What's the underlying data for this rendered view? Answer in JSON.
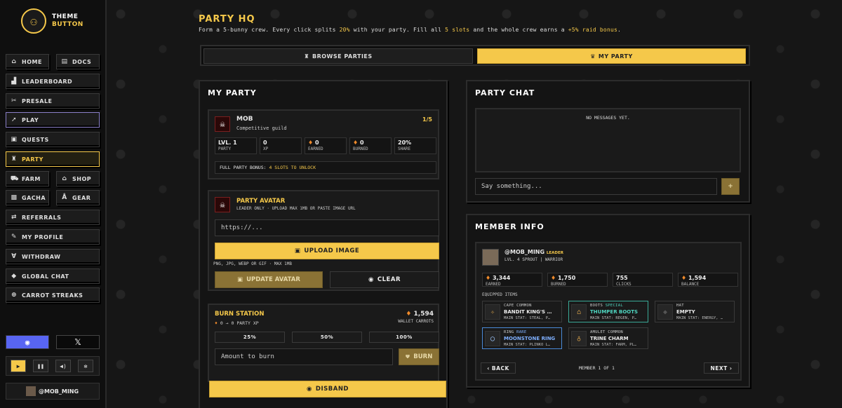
{
  "sidebar": {
    "logo": {
      "line1": "THEME",
      "line2": "BUTTON"
    },
    "nav": {
      "home": "HOME",
      "docs": "DOCS",
      "leaderboard": "LEADERBOARD",
      "presale": "PRESALE",
      "play": "PLAY",
      "quests": "QUESTS",
      "party": "PARTY",
      "farm": "FARM",
      "shop": "SHOP",
      "gacha": "GACHA",
      "gear": "GEAR",
      "referrals": "REFERRALS",
      "profile": "MY PROFILE",
      "withdraw": "WITHDRAW",
      "global_chat": "GLOBAL CHAT",
      "carrot_streaks": "CARROT STREAKS"
    },
    "social": {
      "x": "𝕏"
    },
    "user": {
      "name": "@MOB_MING"
    }
  },
  "header": {
    "title": "PARTY HQ",
    "sub_parts": [
      "Form a 5-bunny crew. Every click splits ",
      "20%",
      " with your party. Fill all ",
      "5 slots",
      " and the whole crew earns a ",
      "+5% raid bonus",
      "."
    ]
  },
  "tabs": {
    "browse": "BROWSE PARTIES",
    "mine": "MY PARTY"
  },
  "my_party": {
    "title": "MY PARTY",
    "name": "MOB",
    "desc": "Competitive guild",
    "count": "1/5",
    "stats": {
      "level": {
        "value": "LVL. 1",
        "label": "PARTY"
      },
      "xp": {
        "value": "0",
        "label": "XP"
      },
      "earned": {
        "value": "0",
        "label": "EARNED"
      },
      "burned": {
        "value": "0",
        "label": "BURNED"
      },
      "share": {
        "value": "20%",
        "label": "SHARE"
      }
    },
    "bonus_prefix": "FULL PARTY BONUS: ",
    "bonus_value": "4 SLOTS TO UNLOCK"
  },
  "avatar": {
    "title": "PARTY AVATAR",
    "desc": "LEADER ONLY · UPLOAD MAX 1MB OR PASTE IMAGE URL",
    "url_placeholder": "https://...",
    "upload": "UPLOAD IMAGE",
    "formats": "PNG, JPG, WEBP OR GIF · MAX 1MB",
    "update": "UPDATE AVATAR",
    "clear": "CLEAR"
  },
  "burn": {
    "title": "BURN STATION",
    "rate_left": "0",
    "rate_right": "→ 0 PARTY XP",
    "wallet_value": "1,594",
    "wallet_label": "WALLET CARROTS",
    "p25": "25%",
    "p50": "50%",
    "p100": "100%",
    "amount_placeholder": "Amount to burn",
    "burn_btn": "BURN"
  },
  "disband": "DISBAND",
  "chat": {
    "title": "PARTY CHAT",
    "empty": "NO MESSAGES YET.",
    "placeholder": "Say something...",
    "send_icon": "+"
  },
  "member": {
    "title": "MEMBER INFO",
    "handle": "@MOB_MING",
    "role": "LEADER",
    "sub_left": "LVL. 4 SPROUT",
    "sub_right": "WARRIOR",
    "stats": {
      "earned": {
        "value": "3,344",
        "label": "EARNED"
      },
      "burned": {
        "value": "1,750",
        "label": "BURNED"
      },
      "clicks": {
        "value": "755",
        "label": "CLICKS"
      },
      "balance": {
        "value": "1,594",
        "label": "BALANCE"
      }
    },
    "equipped_label": "EQUIPPED ITEMS",
    "items": [
      {
        "slot": "CAPE",
        "rarity": "COMMON",
        "name": "BANDIT KING'S …",
        "stat": "MAIN STAT: STEAL, P…"
      },
      {
        "slot": "BOOTS",
        "rarity": "SPECIAL",
        "name": "THUMPER BOOTS",
        "stat": "MAIN STAT: REGEN, P…"
      },
      {
        "slot": "HAT",
        "rarity": "",
        "name": "EMPTY",
        "stat": "MAIN STAT: ENERGY, …"
      },
      {
        "slot": "RING",
        "rarity": "RARE",
        "name": "MOONSTONE RING",
        "stat": "MAIN STAT: PLINKO L…"
      },
      {
        "slot": "AMULET",
        "rarity": "COMMON",
        "name": "TRINE CHARM",
        "stat": "MAIN STAT: FARM, PL…"
      }
    ],
    "back": "‹ BACK",
    "page": "MEMBER 1 OF 1",
    "next": "NEXT ›"
  }
}
